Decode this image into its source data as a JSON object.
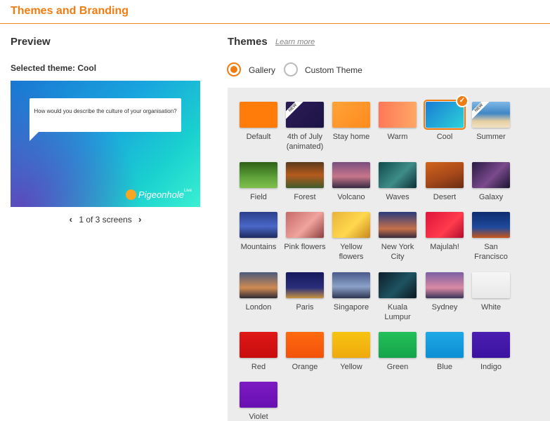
{
  "header": {
    "title": "Themes and Branding"
  },
  "preview": {
    "title": "Preview",
    "selected_label": "Selected theme: Cool",
    "question": "How would you describe the culture of your organisation?",
    "logo_text": "Pigeonhole",
    "logo_sup": "Live",
    "pager_text": "1 of 3 screens"
  },
  "themes": {
    "title": "Themes",
    "learn_more": "Learn more",
    "options": {
      "gallery": "Gallery",
      "custom": "Custom Theme"
    },
    "selected_option": "Gallery",
    "selected_theme": "Cool",
    "new_badge": "NEW",
    "items": [
      {
        "label": "Default"
      },
      {
        "label": "4th of July (animated)",
        "badge": "NEW"
      },
      {
        "label": "Stay home"
      },
      {
        "label": "Warm"
      },
      {
        "label": "Cool",
        "selected": true
      },
      {
        "label": "Summer",
        "badge": "NEW"
      },
      {
        "label": "Field"
      },
      {
        "label": "Forest"
      },
      {
        "label": "Volcano"
      },
      {
        "label": "Waves"
      },
      {
        "label": "Desert"
      },
      {
        "label": "Galaxy"
      },
      {
        "label": "Mountains"
      },
      {
        "label": "Pink flowers"
      },
      {
        "label": "Yellow flowers"
      },
      {
        "label": "New York City"
      },
      {
        "label": "Majulah!"
      },
      {
        "label": "San Francisco"
      },
      {
        "label": "London"
      },
      {
        "label": "Paris"
      },
      {
        "label": "Singapore"
      },
      {
        "label": "Kuala Lumpur"
      },
      {
        "label": "Sydney"
      },
      {
        "label": "White"
      },
      {
        "label": "Red"
      },
      {
        "label": "Orange"
      },
      {
        "label": "Yellow"
      },
      {
        "label": "Green"
      },
      {
        "label": "Blue"
      },
      {
        "label": "Indigo"
      },
      {
        "label": "Violet"
      }
    ]
  },
  "colors": {
    "accent": "#f07d12",
    "gallery_bg": "#ececec"
  }
}
